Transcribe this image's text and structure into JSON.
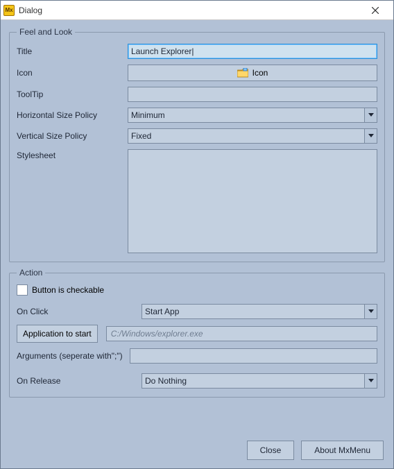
{
  "window": {
    "title": "Dialog"
  },
  "feel": {
    "legend": "Feel and Look",
    "title_label": "Title",
    "title_value": "Launch Explorer",
    "icon_label": "Icon",
    "icon_button_label": "Icon",
    "tooltip_label": "ToolTip",
    "tooltip_value": "",
    "hpolicy_label": "Horizontal Size Policy",
    "hpolicy_value": "Minimum",
    "vpolicy_label": "Vertical Size Policy",
    "vpolicy_value": "Fixed",
    "stylesheet_label": "Stylesheet",
    "stylesheet_value": ""
  },
  "action": {
    "legend": "Action",
    "checkable_label": "Button is checkable",
    "checkable_checked": false,
    "onclick_label": "On Click",
    "onclick_value": "Start App",
    "app_button_label": "Application to start",
    "app_path_placeholder": "C:/Windows/explorer.exe",
    "args_label": "Arguments (seperate with\";\")",
    "args_value": "",
    "onrelease_label": "On Release",
    "onrelease_value": "Do Nothing"
  },
  "footer": {
    "close_label": "Close",
    "about_label": "About MxMenu"
  }
}
